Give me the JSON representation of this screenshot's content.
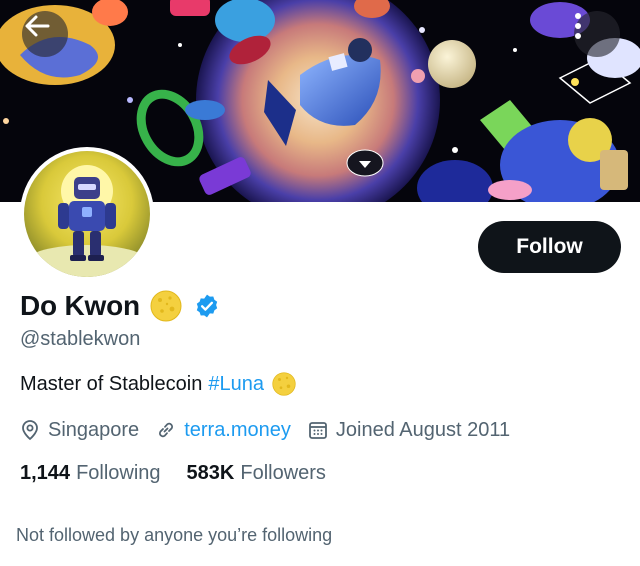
{
  "profile": {
    "name": "Do Kwon",
    "handle": "@stablekwon",
    "bio_text": "Master of Stablecoin",
    "bio_hashtag": "#Luna",
    "location": "Singapore",
    "website": "terra.money",
    "joined": "Joined August 2011",
    "following_count": "1,144",
    "following_label": "Following",
    "followers_count": "583K",
    "followers_label": "Followers",
    "followed_note": "Not followed by anyone you’re following"
  },
  "actions": {
    "follow_label": "Follow"
  },
  "icons": {
    "back": "arrow-left-icon",
    "more": "more-vertical-icon",
    "verified": "verified-badge-icon",
    "moon_emoji": "full-moon-face-icon",
    "location": "location-pin-icon",
    "link": "link-icon",
    "calendar": "calendar-icon"
  },
  "colors": {
    "accent": "#1d9bf0",
    "follow_button_bg": "#0f1419",
    "secondary_text": "#536471",
    "moon": "#f4d03f"
  }
}
